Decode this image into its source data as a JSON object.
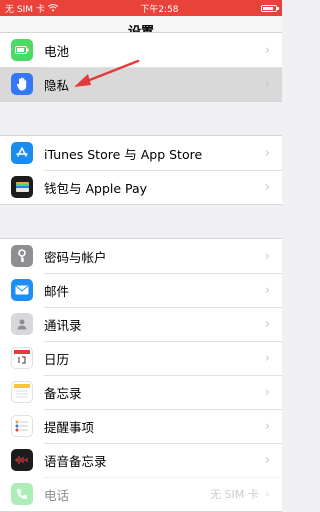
{
  "status": {
    "carrier": "无 SIM 卡",
    "time": "下午2:58"
  },
  "nav": {
    "title": "设置"
  },
  "settings": {
    "top": [
      {
        "label": "电池",
        "icon": "battery-icon"
      },
      {
        "label": "隐私",
        "icon": "hand-icon"
      }
    ],
    "store": [
      {
        "label": "iTunes Store 与 App Store",
        "icon": "app-store-icon"
      },
      {
        "label": "钱包与 Apple Pay",
        "icon": "wallet-icon"
      }
    ],
    "apps": [
      {
        "label": "密码与帐户",
        "icon": "key-icon"
      },
      {
        "label": "邮件",
        "icon": "mail-icon"
      },
      {
        "label": "通讯录",
        "icon": "contacts-icon"
      },
      {
        "label": "日历",
        "icon": "calendar-icon"
      },
      {
        "label": "备忘录",
        "icon": "notes-icon"
      },
      {
        "label": "提醒事项",
        "icon": "reminders-icon"
      },
      {
        "label": "语音备忘录",
        "icon": "voice-memos-icon"
      },
      {
        "label": "电话",
        "value": "无 SIM 卡",
        "icon": "phone-icon"
      }
    ]
  },
  "colors": {
    "status_bar": "#e8423a",
    "battery": "#4cd964",
    "privacy": "#3478f6",
    "app_store": "#1a8cf0",
    "wallet": "#1c1c1e",
    "key": "#8e8e93",
    "mail": "#1d8ef5",
    "phone": "#4cd964",
    "arrow": "#e23b3b"
  }
}
